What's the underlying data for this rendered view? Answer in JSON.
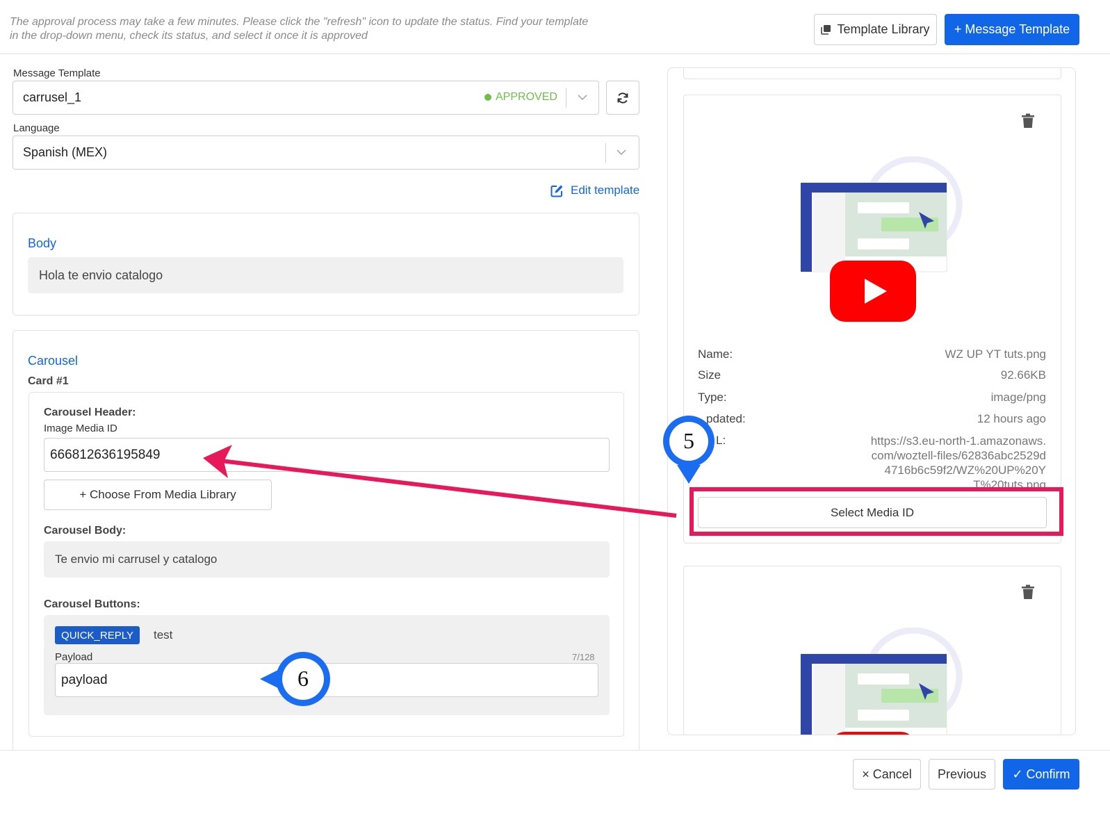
{
  "header": {
    "notice": "The approval process may take a few minutes. Please click the \"refresh\" icon to update the status. Find your template in the drop-down menu, check its status, and select it once it is approved",
    "template_library_label": "Template Library",
    "message_template_label": "+ Message Template"
  },
  "form": {
    "message_template_label": "Message Template",
    "message_template_value": "carrusel_1",
    "status_text": "APPROVED",
    "language_label": "Language",
    "language_value": "Spanish (MEX)",
    "edit_template_label": "Edit template"
  },
  "body_section": {
    "title": "Body",
    "text": "Hola te envio catalogo"
  },
  "carousel": {
    "title": "Carousel",
    "card_title": "Card #1",
    "header_label": "Carousel Header:",
    "media_id_label": "Image Media ID",
    "media_id_value": "666812636195849",
    "choose_media_label": "+ Choose From Media Library",
    "body_label": "Carousel Body:",
    "body_text": "Te envio mi carrusel y catalogo",
    "buttons_label": "Carousel Buttons:",
    "button_type": "QUICK_REPLY",
    "button_text": "test",
    "payload_label": "Payload",
    "payload_counter": "7/128",
    "payload_value": "payload"
  },
  "media": {
    "name_key": "Name:",
    "name_value": "WZ UP YT tuts.png",
    "size_key": "Size",
    "size_value": "92.66KB",
    "type_key": "Type:",
    "type_value": "image/png",
    "updated_key": "Updated:",
    "updated_key_visible": "pdated:",
    "updated_value": "12 hours ago",
    "url_key_visible": "L:",
    "url_line1": "https://s3.eu-north-1.amazonaws.",
    "url_line2": "com/woztell-files/62836abc2529d",
    "url_line3": "4716b6c59f2/WZ%20UP%20Y",
    "url_line4": "T%20tuts.png",
    "select_media_label": "Select Media ID"
  },
  "footer": {
    "cancel_label": "× Cancel",
    "previous_label": "Previous",
    "confirm_label": "✓ Confirm"
  },
  "annotations": {
    "marker_5": "5",
    "marker_6": "6",
    "highlight_color": "#e8195a",
    "marker_color": "#1a6cf0"
  },
  "colors": {
    "primary": "#1166e8",
    "approved": "#6cc04a",
    "youtube_red": "#f00"
  }
}
